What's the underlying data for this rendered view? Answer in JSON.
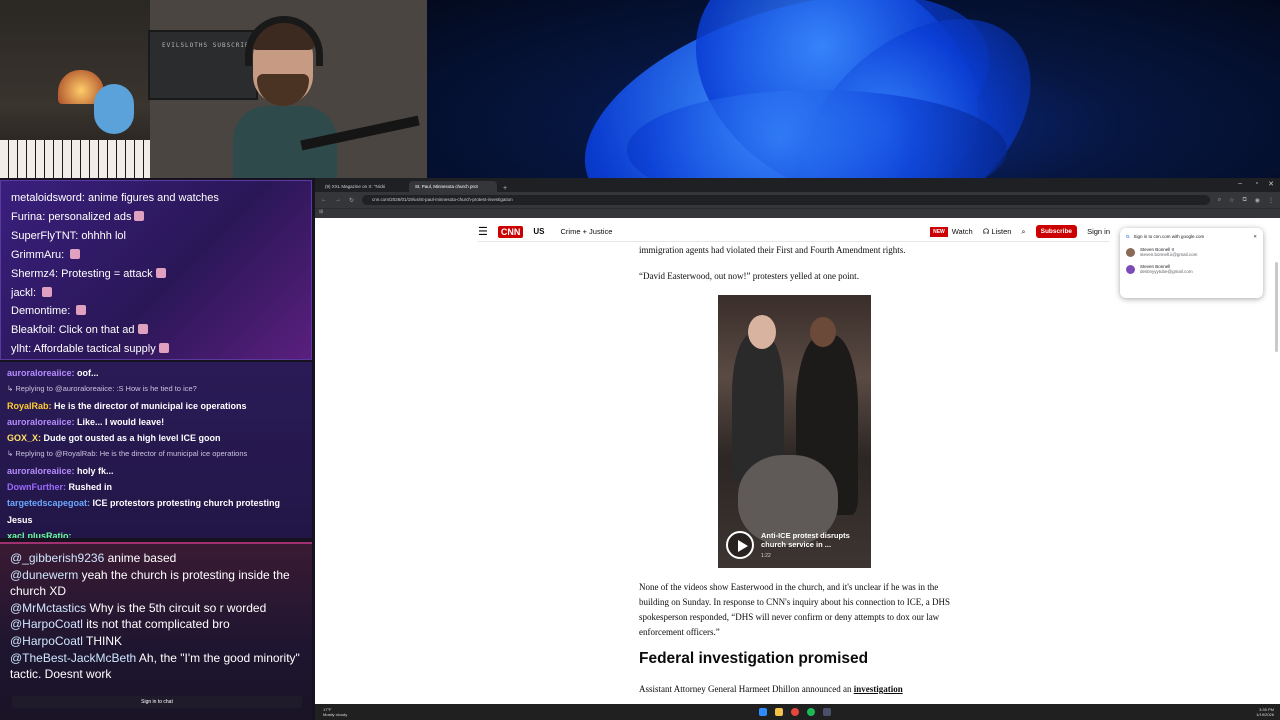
{
  "webcam": {
    "poster_text": "EVILSLOTHS SUBSCRIBE"
  },
  "overlay_chat": [
    {
      "user": "metaloidsword",
      "text": "anime figures and watches",
      "emote": false
    },
    {
      "user": "Furina",
      "text": "personalized ads",
      "emote": true
    },
    {
      "user": "SuperFlyTNT",
      "text": "ohhhh lol",
      "emote": false
    },
    {
      "user": "GrimmAru",
      "text": "",
      "emote": true
    },
    {
      "user": "Shermz4",
      "text": "Protesting = attack",
      "emote": true
    },
    {
      "user": "jackl",
      "text": "",
      "emote": true
    },
    {
      "user": "Demontime",
      "text": "",
      "emote": true
    },
    {
      "user": "Bleakfoil",
      "text": "Click on that ad",
      "emote": true
    },
    {
      "user": "ylht",
      "text": "Affordable tactical supply",
      "emote": true
    }
  ],
  "twitch_chat": [
    {
      "type": "msg",
      "user": "auroraloreaiice",
      "text": "oof...",
      "color": "#b58cff"
    },
    {
      "type": "reply",
      "text": "↳ Replying to @auroraloreaiice: :S How is he tied to ice?"
    },
    {
      "type": "msg",
      "user": "RoyalRab",
      "text": "He is the director of municipal ice operations",
      "color": "#ffcc33"
    },
    {
      "type": "msg",
      "user": "auroraloreaiice",
      "text": "Like... I would leave!",
      "color": "#b58cff"
    },
    {
      "type": "msg",
      "user": "GOX_X",
      "text": "Dude got ousted as a high level ICE goon",
      "color": "#ffe066"
    },
    {
      "type": "reply",
      "text": "↳ Replying to @RoyalRab: He is the director of municipal ice operations"
    },
    {
      "type": "msg",
      "user": "auroraloreaiice",
      "text": "holy fk...",
      "color": "#b58cff"
    },
    {
      "type": "msg",
      "user": "DownFurther",
      "text": "Rushed in",
      "color": "#9b6bff"
    },
    {
      "type": "msg",
      "user": "targetedscapegoat",
      "text": "ICE protestors protesting church protesting Jesus",
      "color": "#6aa8ff"
    },
    {
      "type": "msg",
      "user": "xacLplusRatio",
      "text": "",
      "color": "#66ff99"
    }
  ],
  "yt_chat": [
    {
      "user": "@_gibberish9236",
      "text": "anime based"
    },
    {
      "user": "@dunewerm",
      "text": "yeah the church is protesting inside the church XD"
    },
    {
      "user": "@MrMctastics",
      "text": "Why is the 5th circuit so r worded"
    },
    {
      "user": "@HarpoCoatl",
      "text": "its not that complicated bro"
    },
    {
      "user": "@HarpoCoatl",
      "text": "THINK"
    },
    {
      "user": "@TheBest-JackMcBeth",
      "text": "Ah, the \"I'm the good minority\" tactic. Doesnt work"
    }
  ],
  "chat_signin": "Sign in to chat",
  "browser": {
    "tabs": [
      {
        "label": "(9) XXL Magazine on X: \"Nicki",
        "active": false
      },
      {
        "label": "St. Paul, Minnesota church prot",
        "active": true
      }
    ],
    "url": "cnn.com/2026/01/19/us/st-paul-minnesota-church-protest-investigation"
  },
  "cnn": {
    "logo": "CNN",
    "section": "US",
    "nav": "Crime + Justice",
    "new_badge": "NEW",
    "watch": "Watch",
    "listen": "Listen",
    "subscribe": "Subscribe",
    "signin": "Sign in"
  },
  "article": {
    "p1": "immigration agents had violated their First and Fourth Amendment rights.",
    "p2": "“David Easterwood, out now!” protesters yelled at one point.",
    "video_title": "Anti-ICE protest disrupts church service in ...",
    "video_duration": "1:22",
    "p3": "None of the videos show Easterwood in the church, and it's unclear if he was in the building on Sunday. In response to CNN's inquiry about his connection to ICE, a DHS spokesperson responded, “DHS will never confirm or deny attempts to dox our law enforcement officers.”",
    "heading": "Federal investigation promised",
    "p4_prefix": "Assistant Attorney General Harmeet Dhillon announced an ",
    "p4_link": "investigation"
  },
  "google_popup": {
    "title": "Sign in to cnn.com with google.com",
    "accounts": [
      {
        "name": "Steven Bonnell II",
        "email": "steven.bonnell.ii@gmail.com",
        "color": "#8a6a55"
      },
      {
        "name": "Steven Bonnell",
        "email": "destinyyytube@gmail.com",
        "color": "#7b4bb7"
      }
    ]
  },
  "taskbar": {
    "temp": "17°F",
    "weather": "Mostly cloudy",
    "time": "3:35 PM",
    "date": "1/19/2026"
  }
}
